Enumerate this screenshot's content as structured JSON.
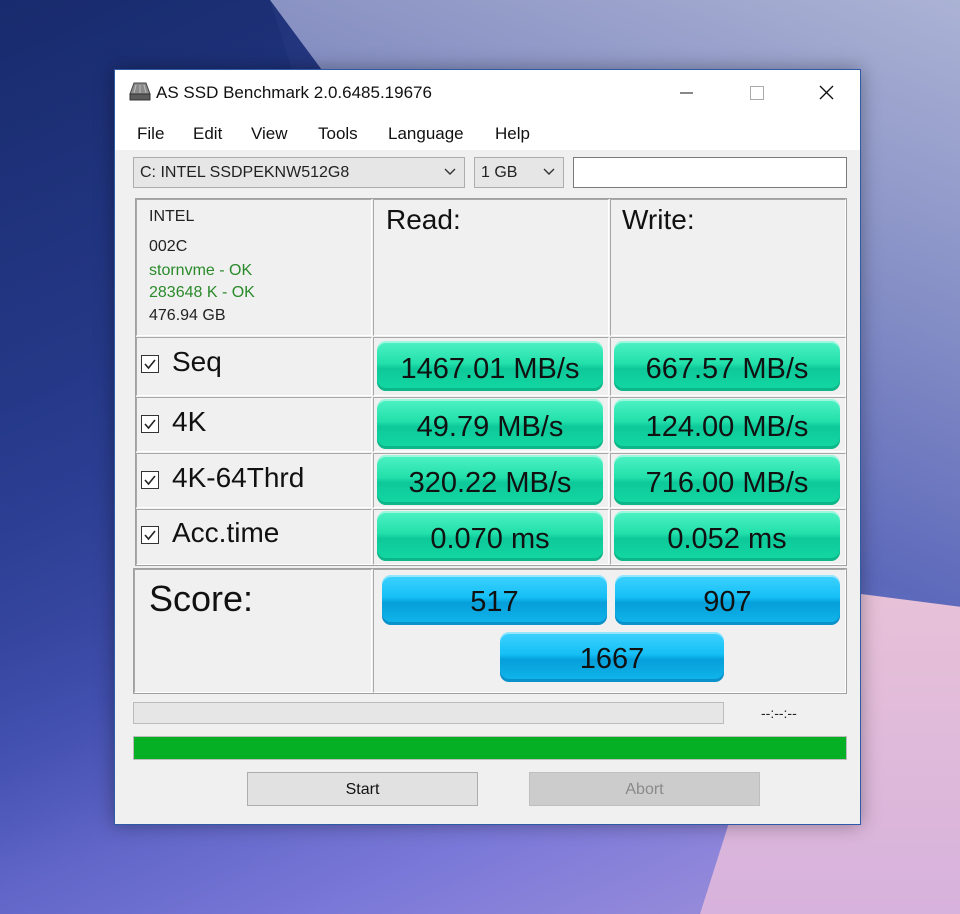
{
  "window": {
    "title": "AS SSD Benchmark 2.0.6485.19676"
  },
  "menu": [
    "File",
    "Edit",
    "View",
    "Tools",
    "Language",
    "Help"
  ],
  "toolbar": {
    "drive_select": "C: INTEL SSDPEKNW512G8",
    "size_select": "1 GB",
    "name_field": ""
  },
  "drive_info": {
    "vendor": "INTEL",
    "firmware": "002C",
    "driver_status": "stornvme - OK",
    "alignment_status": "283648 K - OK",
    "capacity": "476.94 GB"
  },
  "columns": {
    "read": "Read:",
    "write": "Write:"
  },
  "rows": [
    {
      "label": "Seq",
      "checked": true,
      "read": "1467.01 MB/s",
      "write": "667.57 MB/s"
    },
    {
      "label": "4K",
      "checked": true,
      "read": "49.79 MB/s",
      "write": "124.00 MB/s"
    },
    {
      "label": "4K-64Thrd",
      "checked": true,
      "read": "320.22 MB/s",
      "write": "716.00 MB/s"
    },
    {
      "label": "Acc.time",
      "checked": true,
      "read": "0.070 ms",
      "write": "0.052 ms"
    }
  ],
  "score": {
    "label": "Score:",
    "read": "517",
    "write": "907",
    "total": "1667"
  },
  "progress": {
    "elapsed": "--:--:--",
    "current_fraction": 0.0,
    "total_fraction": 1.0
  },
  "buttons": {
    "start": "Start",
    "abort": "Abort"
  },
  "colors": {
    "result_pill": "#22e0aa",
    "score_pill": "#14bff5",
    "progress_fill": "#06b025",
    "status_ok": "#2a8a2a"
  }
}
